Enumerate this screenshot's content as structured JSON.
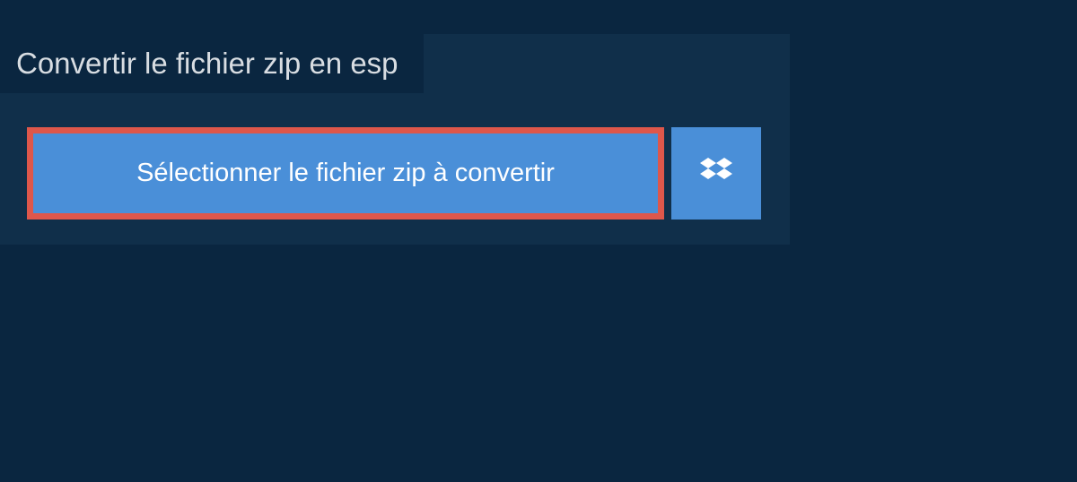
{
  "header": {
    "title": "Convertir le fichier zip en esp"
  },
  "actions": {
    "select_file_label": "Sélectionner le fichier zip à convertir"
  },
  "colors": {
    "page_bg": "#0a2640",
    "panel_bg": "#102f4a",
    "button_bg": "#4a8fd8",
    "highlight_border": "#de574b"
  }
}
